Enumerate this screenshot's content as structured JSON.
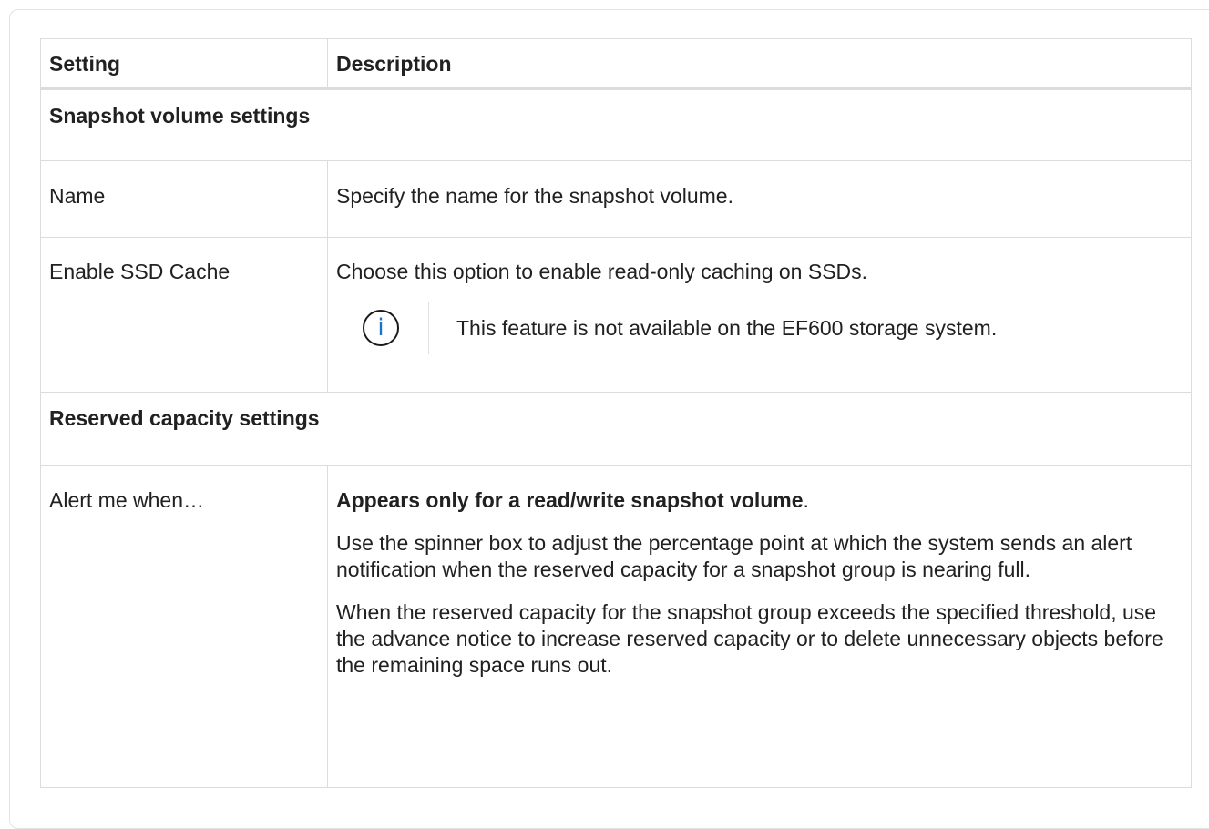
{
  "table": {
    "headers": [
      "Setting",
      "Description"
    ],
    "sections": [
      {
        "title": "Snapshot volume settings",
        "rows": [
          {
            "setting": "Name",
            "description": "Specify the name for the snapshot volume."
          },
          {
            "setting": "Enable SSD Cache",
            "description": "Choose this option to enable read-only caching on SSDs.",
            "note_icon": "info-icon",
            "note": "This feature is not available on the EF600 storage system."
          }
        ]
      },
      {
        "title": "Reserved capacity settings",
        "rows": [
          {
            "setting": "Alert me when…",
            "description_bold": "Appears only for a read/write snapshot volume",
            "description_bold_suffix": ".",
            "paragraphs": [
              "Use the spinner box to adjust the percentage point at which the system sends an alert notification when the reserved capacity for a snapshot group is nearing full.",
              "When the reserved capacity for the snapshot group exceeds the specified threshold, use the advance notice to increase reserved capacity or to delete unnecessary objects before the remaining space runs out."
            ]
          }
        ]
      }
    ]
  },
  "colors": {
    "info_icon": "#1b73c7",
    "border": "#dcdcdc"
  }
}
